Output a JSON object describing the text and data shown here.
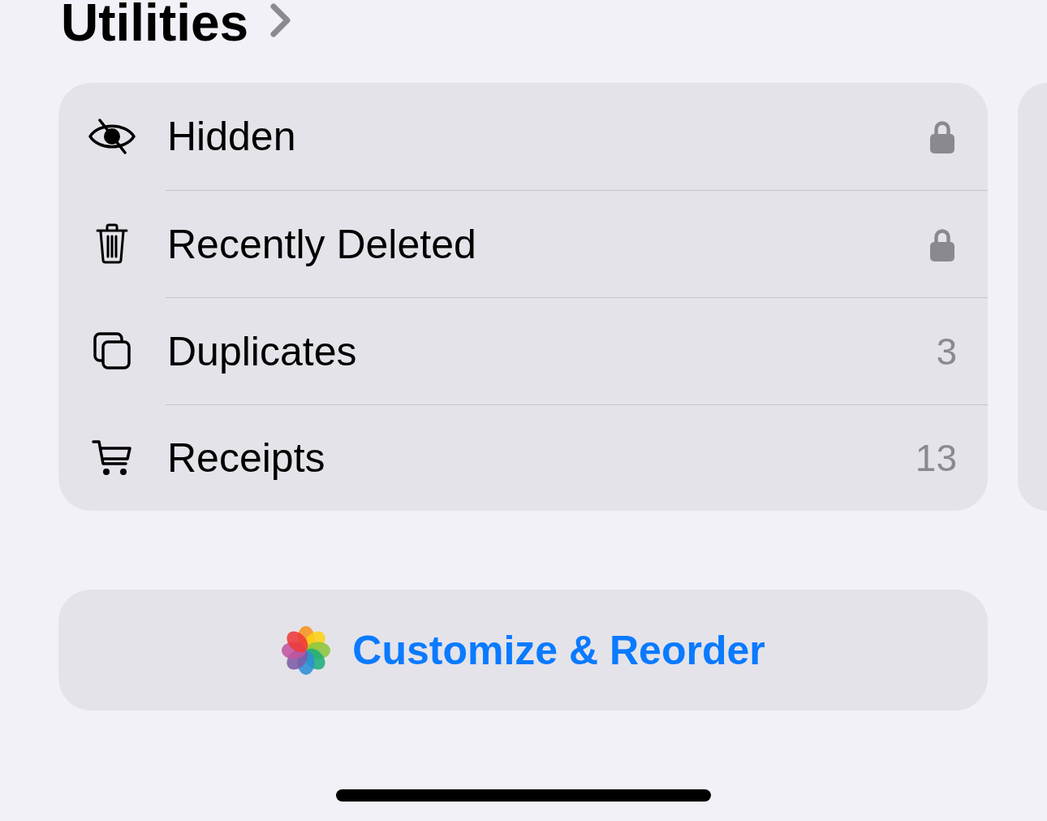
{
  "header": {
    "title": "Utilities"
  },
  "utilities": [
    {
      "label": "Hidden",
      "kind": "locked"
    },
    {
      "label": "Recently Deleted",
      "kind": "locked"
    },
    {
      "label": "Duplicates",
      "kind": "count",
      "count": "3"
    },
    {
      "label": "Receipts",
      "kind": "count",
      "count": "13"
    }
  ],
  "action_button": {
    "label": "Customize & Reorder"
  }
}
